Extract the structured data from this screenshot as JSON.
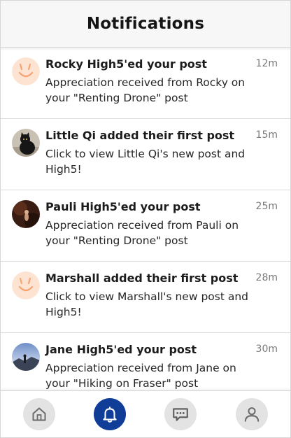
{
  "header": {
    "title": "Notifications"
  },
  "notifications": [
    {
      "title": "Rocky High5'ed your post",
      "body": "Appreciation received from Rocky on your \"Renting Drone\" post",
      "time": "12m",
      "avatar": "smiley-avatar"
    },
    {
      "title": "Little Qi added their first post",
      "body": "Click to view Little Qi's new post and High5!",
      "time": "15m",
      "avatar": "cat-photo-avatar"
    },
    {
      "title": "Pauli High5'ed your post",
      "body": "Appreciation received from Pauli on your \"Renting Drone\" post",
      "time": "25m",
      "avatar": "dark-photo-avatar"
    },
    {
      "title": "Marshall added their first post",
      "body": "Click to view Marshall's new post and High5!",
      "time": "28m",
      "avatar": "smiley-avatar"
    },
    {
      "title": "Jane High5'ed your post",
      "body": "Appreciation received from Jane on your \"Hiking on Fraser\" post",
      "time": "30m",
      "avatar": "landscape-photo-avatar"
    }
  ],
  "bottom_nav": {
    "items": [
      {
        "name": "home",
        "icon": "home-icon",
        "active": false
      },
      {
        "name": "notifications",
        "icon": "bell-icon",
        "active": true
      },
      {
        "name": "messages",
        "icon": "chat-icon",
        "active": false
      },
      {
        "name": "profile",
        "icon": "user-icon",
        "active": false
      }
    ]
  },
  "colors": {
    "accent": "#103d97",
    "nav_inactive": "#e3e3e3",
    "smiley_bg": "#fde3d2",
    "smiley_stroke": "#f5a574",
    "time_text": "#7a7a7a"
  }
}
